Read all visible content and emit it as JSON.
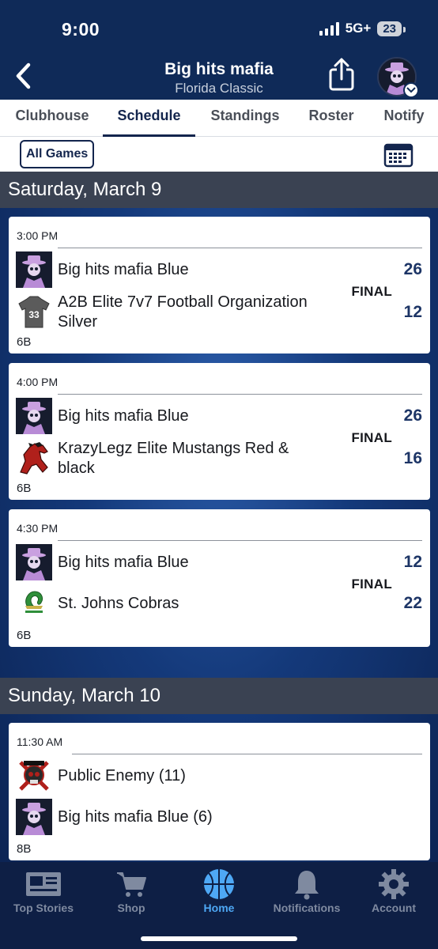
{
  "status": {
    "time": "9:00",
    "network": "5G+",
    "battery": "23"
  },
  "header": {
    "title": "Big hits mafia",
    "subtitle": "Florida Classic"
  },
  "tabs": [
    {
      "label": "Clubhouse"
    },
    {
      "label": "Schedule"
    },
    {
      "label": "Standings"
    },
    {
      "label": "Roster"
    },
    {
      "label": "Notify"
    }
  ],
  "active_tab": "Schedule",
  "filter": {
    "label": "All Games"
  },
  "days": [
    {
      "label": "Saturday, March 9",
      "games": [
        {
          "time": "3:00 PM",
          "home": "Big hits mafia Blue",
          "home_score": "26",
          "away": "A2B Elite 7v7 Football Organization Silver",
          "away_score": "12",
          "status": "FINAL",
          "field": "6B"
        },
        {
          "time": "4:00 PM",
          "home": "Big hits mafia Blue",
          "home_score": "26",
          "away": "KrazyLegz Elite Mustangs Red & black",
          "away_score": "16",
          "status": "FINAL",
          "field": "6B"
        },
        {
          "time": "4:30 PM",
          "home": "Big hits mafia Blue",
          "home_score": "12",
          "away": "St. Johns Cobras",
          "away_score": "22",
          "status": "FINAL",
          "field": "6B"
        }
      ]
    },
    {
      "label": "Sunday, March 10",
      "games": [
        {
          "time": "11:30 AM",
          "home": "Public Enemy (11)",
          "away": "Big hits mafia Blue (6)",
          "field": "8B"
        }
      ]
    }
  ],
  "jersey_number": "33",
  "bottom_nav": [
    {
      "label": "Top Stories",
      "icon": "newspaper-icon"
    },
    {
      "label": "Shop",
      "icon": "cart-icon"
    },
    {
      "label": "Home",
      "icon": "basketball-icon"
    },
    {
      "label": "Notifications",
      "icon": "bell-icon"
    },
    {
      "label": "Account",
      "icon": "gear-icon"
    }
  ],
  "colors": {
    "navy": "#0f2a58",
    "active_blue": "#4ea8f5",
    "score_blue": "#1d3566",
    "day_header": "#3a4252"
  }
}
